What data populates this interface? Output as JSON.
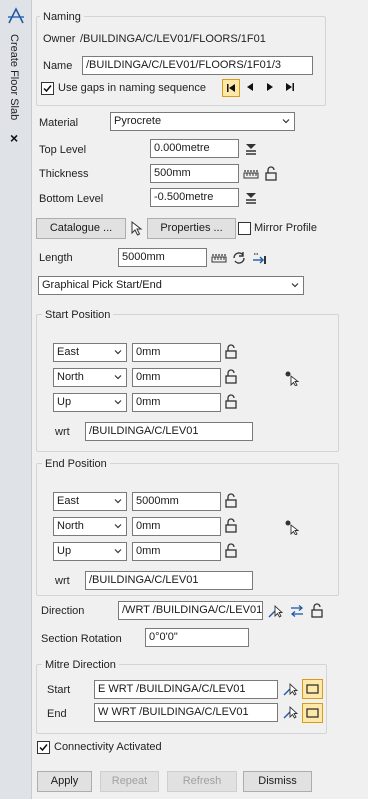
{
  "sidebar": {
    "title": "Create Floor Slab"
  },
  "naming": {
    "group_label": "Naming",
    "owner_label": "Owner",
    "owner_value": "/BUILDINGA/C/LEV01/FLOORS/1F01",
    "name_label": "Name",
    "name_value": "/BUILDINGA/C/LEV01/FLOORS/1F01/3",
    "use_gaps_label": "Use gaps in naming sequence",
    "use_gaps_checked": true
  },
  "material": {
    "label": "Material",
    "value": "Pyrocrete"
  },
  "top_level": {
    "label": "Top Level",
    "value": "0.000metre"
  },
  "thickness": {
    "label": "Thickness",
    "value": "500mm"
  },
  "bottom_level": {
    "label": "Bottom Level",
    "value": "-0.500metre"
  },
  "buttons": {
    "catalogue": "Catalogue ...",
    "properties": "Properties ...",
    "mirror_profile": "Mirror Profile",
    "apply": "Apply",
    "repeat": "Repeat",
    "refresh": "Refresh",
    "dismiss": "Dismiss"
  },
  "length": {
    "label": "Length",
    "value": "5000mm"
  },
  "pick_mode": {
    "value": "Graphical Pick Start/End"
  },
  "start_position": {
    "group_label": "Start Position",
    "rows": [
      {
        "axis": "East",
        "value": "0mm"
      },
      {
        "axis": "North",
        "value": "0mm"
      },
      {
        "axis": "Up",
        "value": "0mm"
      }
    ],
    "wrt_label": "wrt",
    "wrt_value": "/BUILDINGA/C/LEV01"
  },
  "end_position": {
    "group_label": "End Position",
    "rows": [
      {
        "axis": "East",
        "value": "5000mm"
      },
      {
        "axis": "North",
        "value": "0mm"
      },
      {
        "axis": "Up",
        "value": "0mm"
      }
    ],
    "wrt_label": "wrt",
    "wrt_value": "/BUILDINGA/C/LEV01"
  },
  "direction": {
    "label": "Direction",
    "value": "/WRT /BUILDINGA/C/LEV01"
  },
  "section_rotation": {
    "label": "Section Rotation",
    "value": "0°0'0\""
  },
  "mitre": {
    "group_label": "Mitre Direction",
    "start_label": "Start",
    "start_value": "E WRT /BUILDINGA/C/LEV01",
    "end_label": "End",
    "end_value": "W WRT /BUILDINGA/C/LEV01"
  },
  "connectivity": {
    "label": "Connectivity Activated",
    "checked": true
  },
  "colors": {
    "accent": "#1e5aa8",
    "highlight": "#fde8a8",
    "highlight_border": "#d89c1c"
  }
}
